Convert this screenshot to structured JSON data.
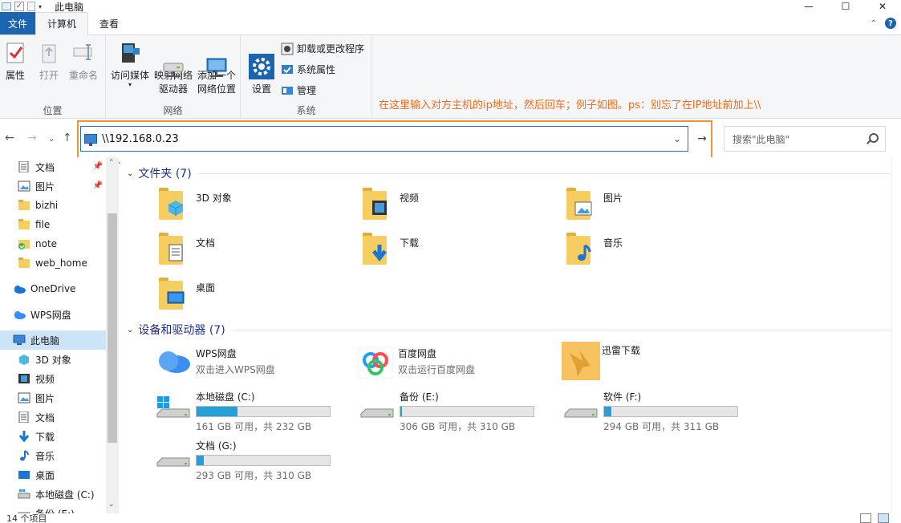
{
  "window": {
    "title": "此电脑",
    "controls": [
      "—",
      "☐",
      "✕"
    ]
  },
  "ribbon": {
    "tabs": [
      {
        "label": "文件"
      },
      {
        "label": "计算机"
      },
      {
        "label": "查看"
      }
    ],
    "help": "?",
    "groups": {
      "location": {
        "label": "位置",
        "buttons": [
          {
            "label": "属性"
          },
          {
            "label": "打开"
          },
          {
            "label": "重命名"
          }
        ]
      },
      "network": {
        "label": "网络",
        "buttons": [
          {
            "label": "访问媒体"
          },
          {
            "label": "映射网络\n驱动器"
          },
          {
            "label": "添加一个\n网络位置"
          }
        ]
      },
      "system": {
        "label": "系统",
        "open_settings": "打开\n设置",
        "small_buttons": [
          {
            "label": "卸载或更改程序"
          },
          {
            "label": "系统属性"
          },
          {
            "label": "管理"
          }
        ]
      }
    }
  },
  "annotation": "在这里输入对方主机的ip地址，然后回车；例子如图。ps：别忘了在IP地址前加上\\\\",
  "address": {
    "value": "\\\\192.168.0.23"
  },
  "search": {
    "placeholder": "搜索\"此电脑\""
  },
  "sidebar": {
    "items": [
      {
        "label": "文档",
        "pinned": true
      },
      {
        "label": "图片",
        "pinned": true
      },
      {
        "label": "bizhi"
      },
      {
        "label": "file"
      },
      {
        "label": "note"
      },
      {
        "label": "web_home"
      },
      {
        "label": "OneDrive"
      },
      {
        "label": "WPS网盘"
      },
      {
        "label": "此电脑",
        "selected": true
      },
      {
        "label": "3D 对象"
      },
      {
        "label": "视频"
      },
      {
        "label": "图片"
      },
      {
        "label": "文档"
      },
      {
        "label": "下载"
      },
      {
        "label": "音乐"
      },
      {
        "label": "桌面"
      },
      {
        "label": "本地磁盘 (C:)"
      },
      {
        "label": "备份 (E:)"
      }
    ]
  },
  "folders_section": {
    "title": "文件夹 (7)",
    "items": [
      {
        "name": "3D 对象"
      },
      {
        "name": "视频"
      },
      {
        "name": "图片"
      },
      {
        "name": "文档"
      },
      {
        "name": "下载"
      },
      {
        "name": "音乐"
      },
      {
        "name": "桌面"
      }
    ]
  },
  "devices_section": {
    "title": "设备和驱动器 (7)",
    "apps": [
      {
        "name": "WPS网盘",
        "sub": "双击进入WPS网盘"
      },
      {
        "name": "百度网盘",
        "sub": "双击运行百度网盘"
      },
      {
        "name": "迅雷下载",
        "sub": ""
      }
    ],
    "drives": [
      {
        "name": "本地磁盘 (C:)",
        "free": "161 GB 可用，共 232 GB",
        "used_fraction": 0.31
      },
      {
        "name": "备份 (E:)",
        "free": "306 GB 可用，共 310 GB",
        "used_fraction": 0.013
      },
      {
        "name": "软件 (F:)",
        "free": "294 GB 可用，共 311 GB",
        "used_fraction": 0.055
      },
      {
        "name": "文档 (G:)",
        "free": "293 GB 可用，共 310 GB",
        "used_fraction": 0.055
      }
    ]
  },
  "status": {
    "count": "14 个项目"
  },
  "colors": {
    "accent": "#1a64b0",
    "annotation": "#f26b1d",
    "selection": "#cce4f7",
    "drive_fill": "#26a0da"
  }
}
